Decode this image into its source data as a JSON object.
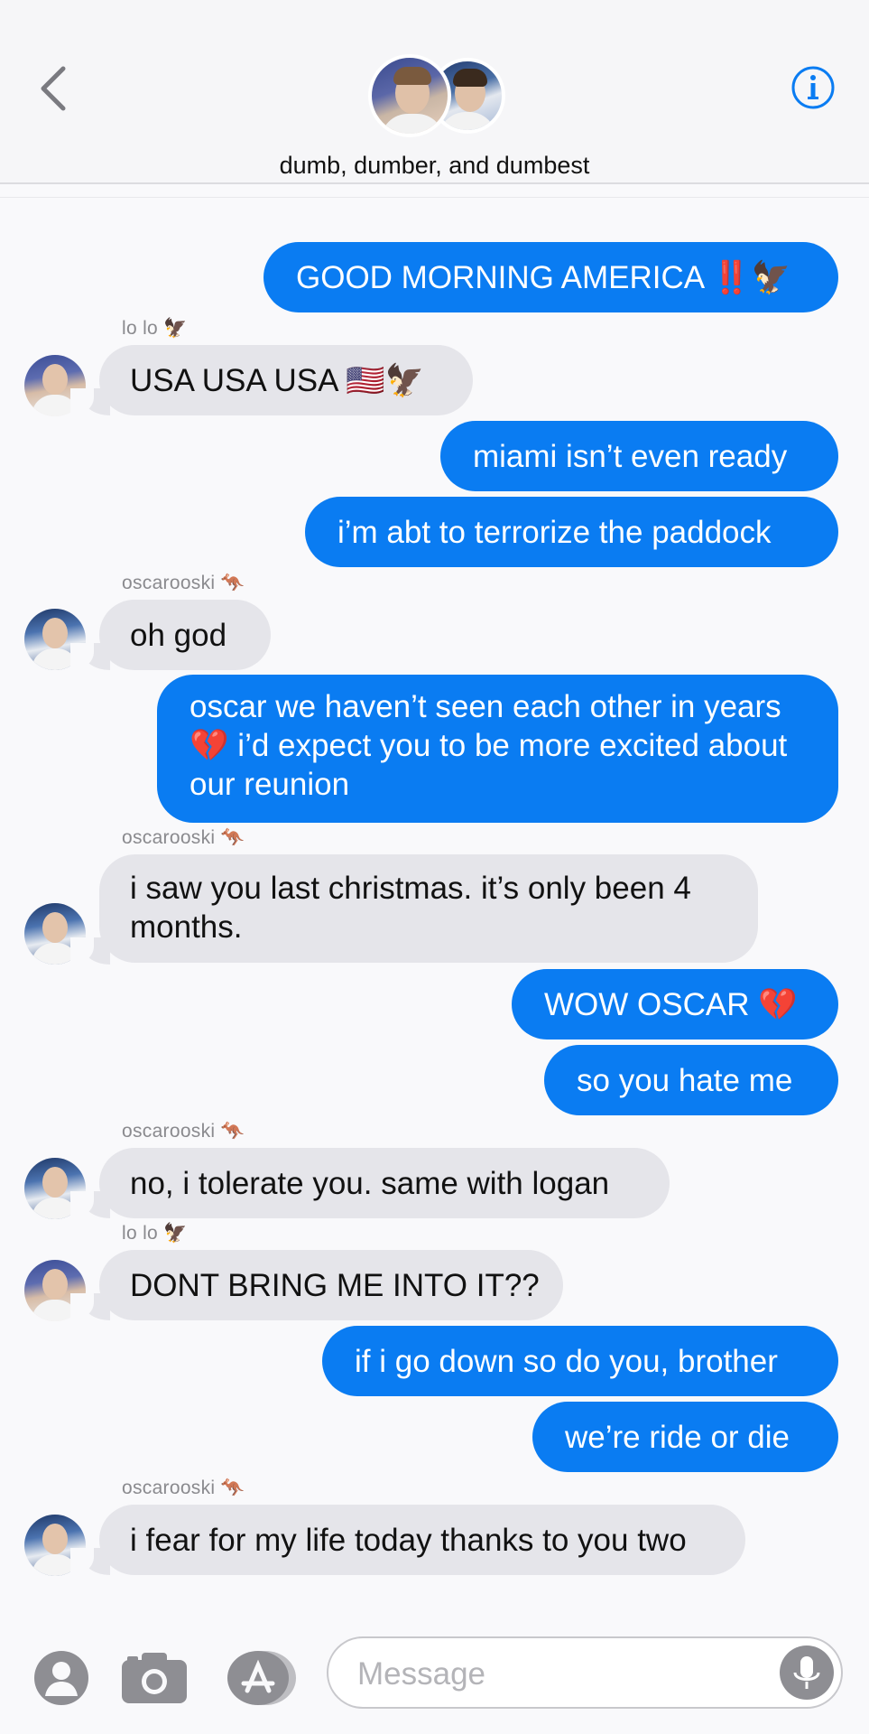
{
  "header": {
    "group_name": "dumb, dumber, and dumbest",
    "back_icon": "chevron-left-icon",
    "info_icon": "info-icon"
  },
  "messages": [
    {
      "from": "me",
      "text": "GOOD MORNING AMERICA ‼️🦅"
    },
    {
      "from": "lo lo",
      "sender_label": "lo lo 🦅",
      "text": "USA USA USA 🇺🇸🦅"
    },
    {
      "from": "me",
      "text": "miami isn’t even ready"
    },
    {
      "from": "me",
      "text": "i’m abt to terrorize the paddock"
    },
    {
      "from": "oscarooski",
      "sender_label": "oscarooski 🦘",
      "text": "oh god"
    },
    {
      "from": "me",
      "text": "oscar we haven’t seen each other in years 💔 i’d expect you to be more excited about our reunion"
    },
    {
      "from": "oscarooski",
      "sender_label": "oscarooski 🦘",
      "text": "i saw you last christmas. it’s only been 4 months."
    },
    {
      "from": "me",
      "text": "WOW OSCAR 💔"
    },
    {
      "from": "me",
      "text": "so you hate me"
    },
    {
      "from": "oscarooski",
      "sender_label": "oscarooski 🦘",
      "text": "no, i tolerate you. same with logan"
    },
    {
      "from": "lo lo",
      "sender_label": "lo lo 🦅",
      "text": "DONT BRING ME INTO IT??"
    },
    {
      "from": "me",
      "text": "if i go down so do you, brother"
    },
    {
      "from": "me",
      "text": "we’re ride or die"
    },
    {
      "from": "oscarooski",
      "sender_label": "oscarooski 🦘",
      "text": "i fear for my life today thanks to you two"
    }
  ],
  "composer": {
    "placeholder": "Message",
    "value": "",
    "contact_icon": "person-icon",
    "camera_icon": "camera-icon",
    "appstore_icon": "app-store-icon",
    "mic_icon": "microphone-icon"
  },
  "colors": {
    "outgoing_bubble": "#0a7cf2",
    "incoming_bubble": "#e5e5ea",
    "accent": "#0a7cf2"
  }
}
